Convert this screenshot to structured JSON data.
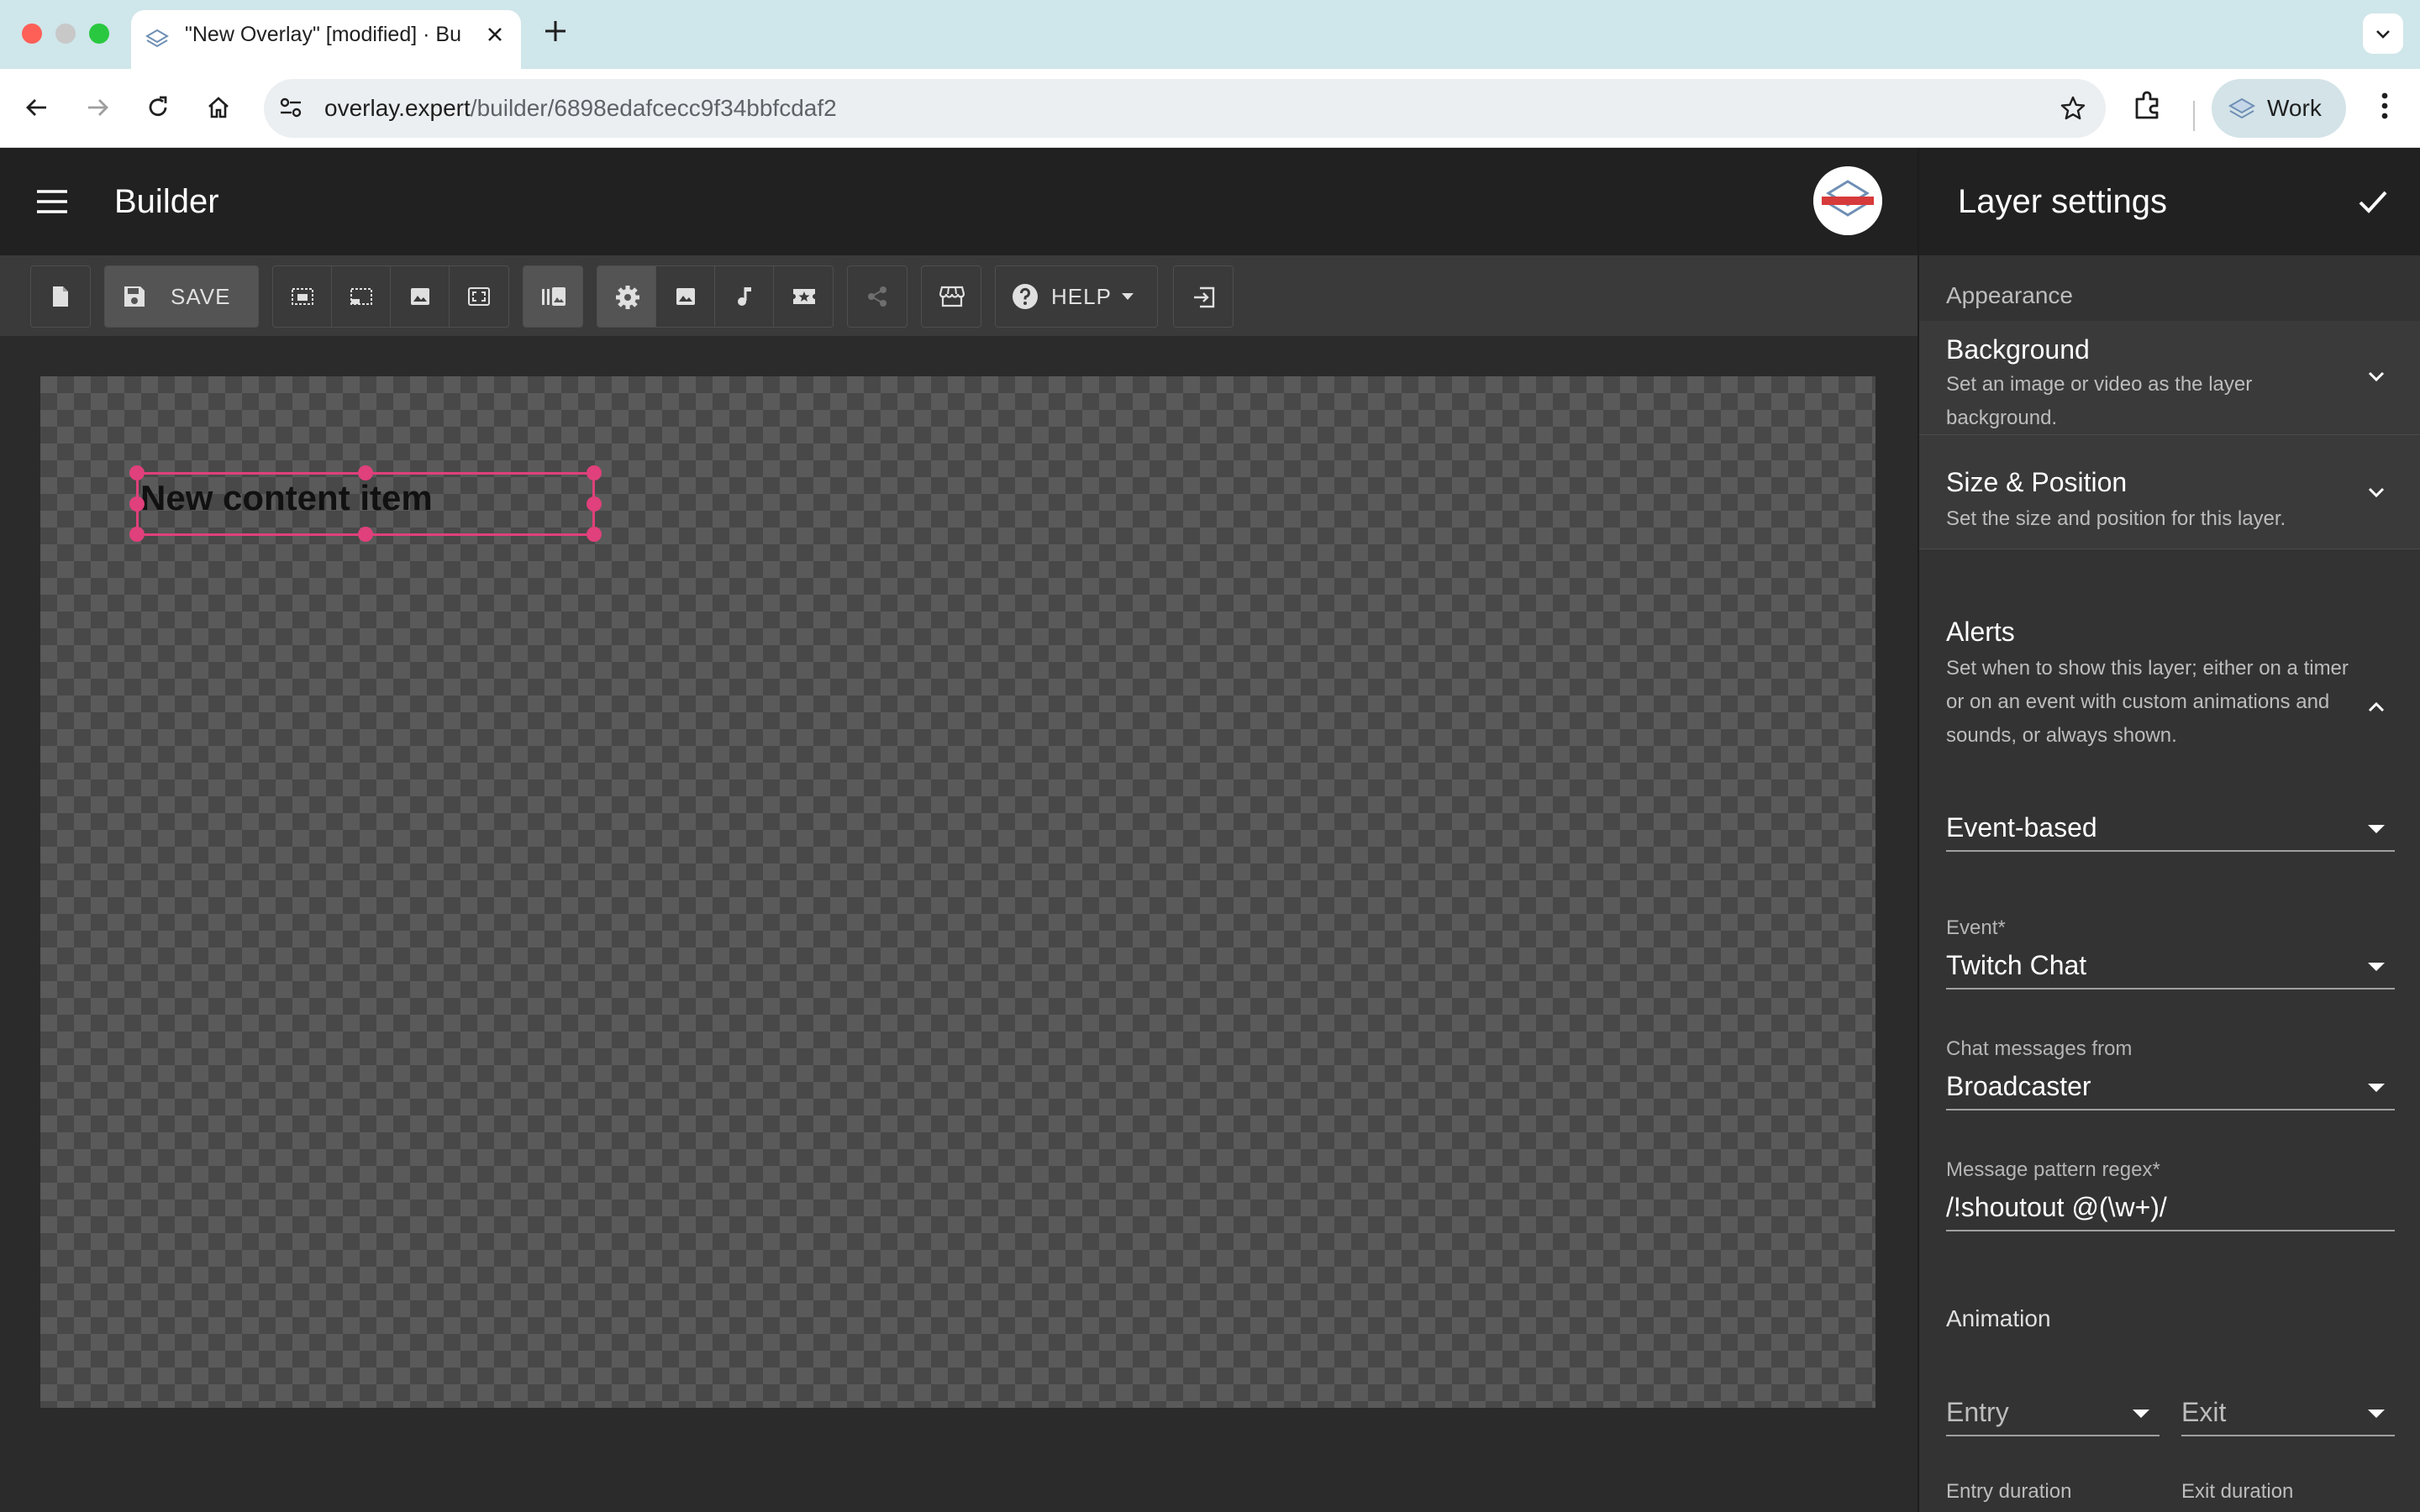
{
  "browser": {
    "tab_title": "\"New Overlay\" [modified] · Bu",
    "url_host": "overlay.expert",
    "url_path": "/builder/6898edafcecc9f34bbfcdaf2",
    "profile_label": "Work"
  },
  "app": {
    "title": "Builder"
  },
  "toolbar": {
    "save_label": "SAVE",
    "help_label": "HELP"
  },
  "canvas": {
    "content_item_text": "New content item"
  },
  "panel": {
    "title": "Layer settings",
    "appearance_label": "Appearance",
    "background": {
      "title": "Background",
      "description": "Set an image or video as the layer background."
    },
    "size_position": {
      "title": "Size & Position",
      "description": "Set the size and position for this layer."
    },
    "alerts": {
      "title": "Alerts",
      "description": "Set when to show this layer; either on a timer or on an event with custom animations and sounds, or always shown.",
      "mode_value": "Event-based",
      "event_label": "Event*",
      "event_value": "Twitch Chat",
      "chat_from_label": "Chat messages from",
      "chat_from_value": "Broadcaster",
      "regex_label": "Message pattern regex*",
      "regex_value": "/!shoutout @(\\w+)/"
    },
    "animation": {
      "title": "Animation",
      "entry_placeholder": "Entry",
      "exit_placeholder": "Exit",
      "entry_duration_label": "Entry duration",
      "exit_duration_label": "Exit duration"
    }
  },
  "colors": {
    "selection": "#e0407b",
    "appbar": "#212121",
    "panel": "#333333"
  }
}
